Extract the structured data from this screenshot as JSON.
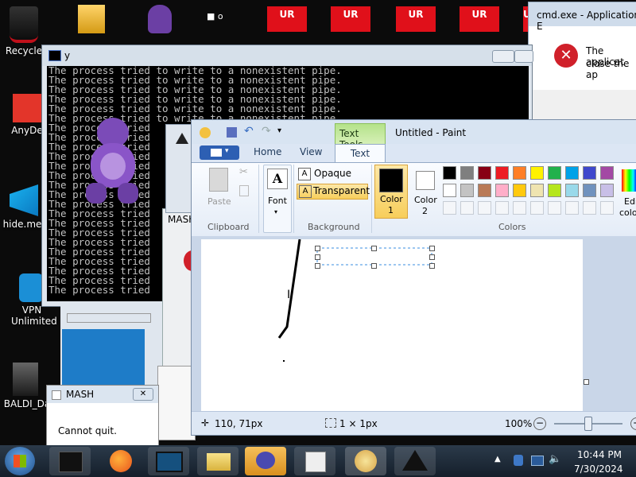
{
  "desktop": {
    "icons": [
      {
        "label": "Recycle"
      },
      {
        "label": "AnyDe"
      },
      {
        "label": "hide.me"
      },
      {
        "label": "VPN Unlimited"
      },
      {
        "label": "BALDI_Da"
      }
    ],
    "ur_tiles": [
      "UR",
      "UR",
      "UR",
      "UR",
      "UR"
    ]
  },
  "cmd_window": {
    "title": "y",
    "line": "The process tried to write to a nonexistent pipe.",
    "short_line": "The process tried",
    "line_count": 24
  },
  "error_dialog": {
    "title": "cmd.exe - Application E",
    "message_1": "The applicat",
    "message_2": "close the ap"
  },
  "mash_back": {
    "title": "MASH"
  },
  "mash_dialog": {
    "title": "MASH",
    "message": "Cannot quit."
  },
  "paint": {
    "contextual_tab": "Text Tools",
    "title": "Untitled - Paint",
    "tabs": {
      "home": "Home",
      "view": "View",
      "text": "Text"
    },
    "clipboard": {
      "paste": "Paste",
      "group": "Clipboard"
    },
    "font": {
      "label": "Font"
    },
    "background": {
      "opaque": "Opaque",
      "transparent": "Transparent",
      "group": "Background"
    },
    "color1": {
      "line1": "Color",
      "line2": "1"
    },
    "color2": {
      "line1": "Color",
      "line2": "2"
    },
    "colors_group": "Colors",
    "edit_colors": {
      "line1": "Edi",
      "line2": "colo"
    },
    "palette": [
      "#000000",
      "#7f7f7f",
      "#880015",
      "#ed1c24",
      "#ff7f27",
      "#fff200",
      "#22b14c",
      "#00a2e8",
      "#3f48cc",
      "#a349a4",
      "#ffffff",
      "#c3c3c3",
      "#b97a57",
      "#ffaec9",
      "#ffc90e",
      "#efe4b0",
      "#b5e61d",
      "#99d9ea",
      "#7092be",
      "#c8bfe7"
    ],
    "status": {
      "position": "110, 71px",
      "selection": "1 × 1px",
      "zoom": "100%"
    }
  },
  "taskbar": {
    "time": "10:44 PM",
    "date": "7/30/2024"
  }
}
